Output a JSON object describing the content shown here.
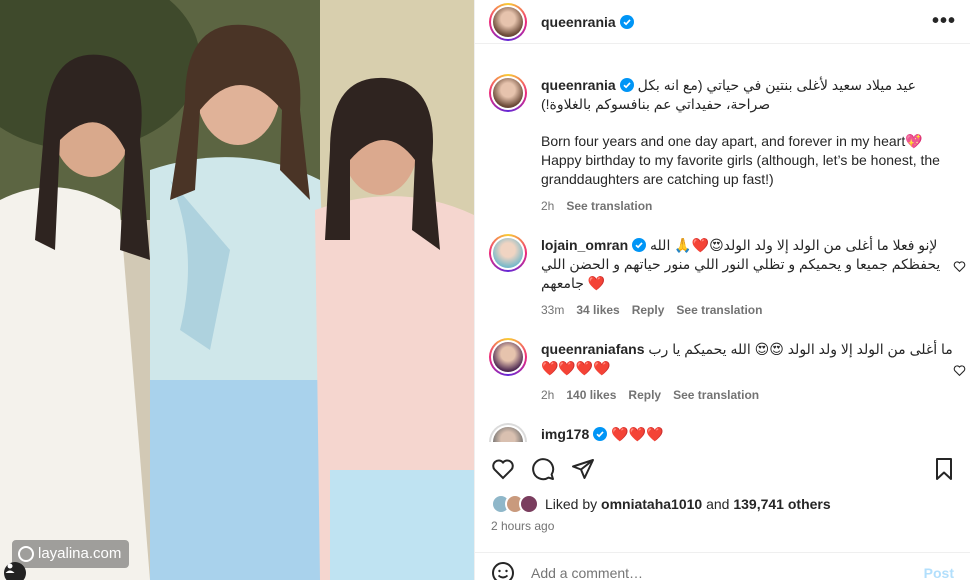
{
  "watermark": {
    "text": "layalina.com"
  },
  "post": {
    "username": "queenrania",
    "more_label": "•••"
  },
  "caption": {
    "username": "queenrania",
    "text_ar": "عيد ميلاد سعيد لأغلى بنتين في حياتي (مع انه بكل صراحة، حفيداتي عم بنافسوكم بالغلاوة!)",
    "text_en_1": "Born four years and one day apart, and forever in my heart💖",
    "text_en_2": "Happy birthday to my favorite girls (although, let’s be honest, the granddaughters are catching up fast!)",
    "time": "2h",
    "see_translation": "See translation"
  },
  "comments": [
    {
      "username": "lojain_omran",
      "text": "لإنو فعلا ما أغلى من الولد إلا ولد الولد😍❤️🙏 الله يحفظكم جميعا و يحميكم و تظلي النور اللي منور حياتهم و الحضن اللي جامعهم ❤️",
      "time": "33m",
      "likes": "34 likes",
      "reply": "Reply",
      "see_translation": "See translation"
    },
    {
      "username": "queenraniafans",
      "text": "ما أغلى من الولد إلا ولد الولد 😍😍 الله يحميكم يا رب ❤️❤️❤️❤️",
      "time": "2h",
      "likes": "140 likes",
      "reply": "Reply",
      "see_translation": "See translation"
    },
    {
      "username": "img178",
      "text": "❤️❤️❤️"
    }
  ],
  "likes": {
    "prefix": "Liked by",
    "user": "omniataha1010",
    "and": "and",
    "count": "139,741 others"
  },
  "time_ago": "2 hours ago",
  "add_comment": {
    "placeholder": "Add a comment…",
    "post_label": "Post"
  },
  "colors": {
    "accent": "#0095f6",
    "verified": "#0095f6",
    "muted": "#737373",
    "post_disabled": "#b2dffc"
  }
}
